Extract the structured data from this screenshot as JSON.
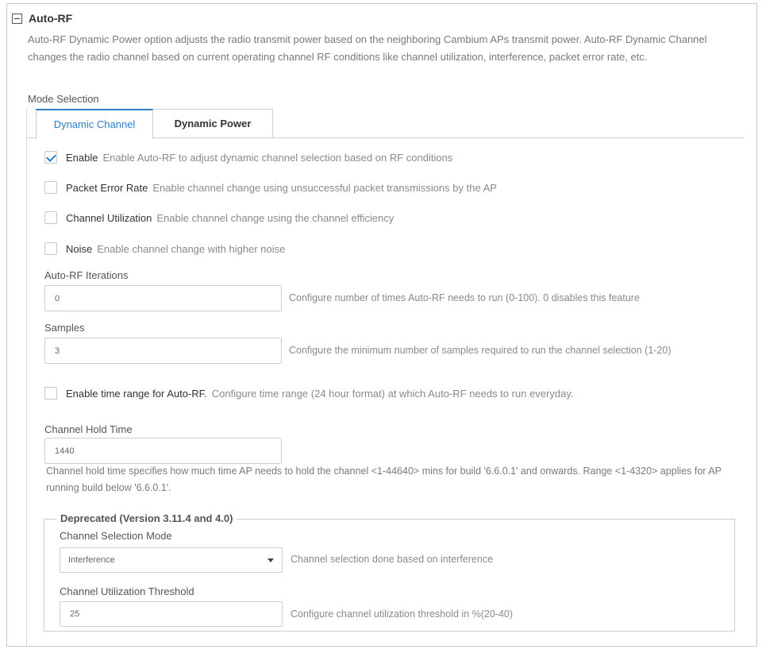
{
  "section": {
    "title": "Auto-RF",
    "description": "Auto-RF Dynamic Power option adjusts the radio transmit power based on the neighboring Cambium APs transmit power. Auto-RF Dynamic Channel changes the radio channel based on current operating channel RF conditions like channel utilization, interference, packet error rate, etc.",
    "mode_label": "Mode Selection"
  },
  "tabs": [
    {
      "label": "Dynamic Channel",
      "active": true
    },
    {
      "label": "Dynamic Power",
      "active": false
    }
  ],
  "options": [
    {
      "label": "Enable",
      "help": "Enable Auto-RF to adjust dynamic channel selection based on RF conditions",
      "checked": true
    },
    {
      "label": "Packet Error Rate",
      "help": "Enable channel change using unsuccessful packet transmissions by the AP",
      "checked": false
    },
    {
      "label": "Channel Utilization",
      "help": "Enable channel change using the channel efficiency",
      "checked": false
    },
    {
      "label": "Noise",
      "help": "Enable channel change with higher noise",
      "checked": false
    }
  ],
  "iterations": {
    "label": "Auto-RF Iterations",
    "value": "0",
    "help": "Configure number of times Auto-RF needs to run (0-100). 0 disables this feature"
  },
  "samples": {
    "label": "Samples",
    "value": "3",
    "help": "Configure the minimum number of samples required to run the channel selection (1-20)"
  },
  "time_range": {
    "label": "Enable time range for Auto-RF.",
    "help": "Configure time range (24 hour format) at which Auto-RF needs to run everyday.",
    "checked": false
  },
  "hold_time": {
    "label": "Channel Hold Time",
    "value": "1440",
    "help": "Channel hold time specifies how much time AP needs to hold the channel <1-44640> mins for build '6.6.0.1' and onwards. Range <1-4320> applies for AP running build below '6.6.0.1'."
  },
  "deprecated": {
    "legend": "Deprecated (Version 3.11.4 and 4.0)",
    "mode_label": "Channel Selection Mode",
    "mode_value": "Interference",
    "mode_help": "Channel selection done based on interference",
    "threshold_label": "Channel Utilization Threshold",
    "threshold_value": "25",
    "threshold_help": "Configure channel utilization threshold in %(20-40)"
  },
  "colors": {
    "accent": "#2f80c8",
    "border": "#cfcfcf"
  }
}
